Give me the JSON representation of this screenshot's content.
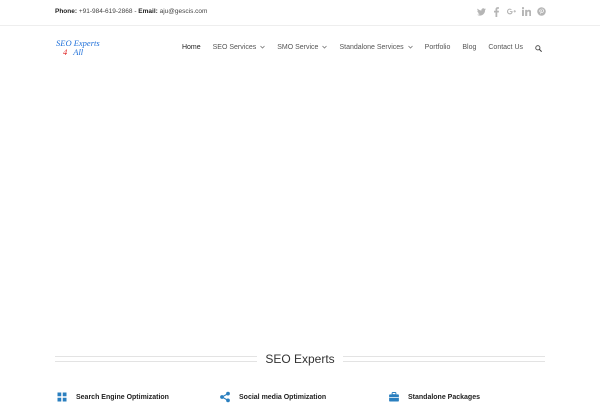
{
  "topbar": {
    "phone_label": "Phone:",
    "phone_value": "+91-984-619-2868",
    "separator": " - ",
    "email_label": "Email:",
    "email_value": "aju@gescis.com",
    "social": [
      "twitter-icon",
      "facebook-icon",
      "google-plus-icon",
      "linkedin-icon",
      "pinterest-icon"
    ]
  },
  "logo": {
    "line1": "SEO Experts",
    "line2_num": "4",
    "line2_word": "All"
  },
  "nav": {
    "items": [
      {
        "label": "Home",
        "active": true
      },
      {
        "label": "SEO Services",
        "dropdown": true
      },
      {
        "label": "SMO Service",
        "dropdown": true
      },
      {
        "label": "Standalone Services",
        "dropdown": true
      },
      {
        "label": "Portfolio"
      },
      {
        "label": "Blog"
      },
      {
        "label": "Contact Us"
      }
    ],
    "search_icon": "search-icon"
  },
  "section": {
    "title": "SEO Experts"
  },
  "features": [
    {
      "label": "Search Engine Optimization",
      "icon": "seo-icon"
    },
    {
      "label": "Social media Optimization",
      "icon": "share-icon"
    },
    {
      "label": "Standalone Packages",
      "icon": "briefcase-icon"
    }
  ],
  "colors": {
    "logo_blue": "#1e6fd9",
    "logo_red": "#e02424",
    "feature_icon": "#2a7fbf",
    "social_grey": "#b5b5b5"
  }
}
